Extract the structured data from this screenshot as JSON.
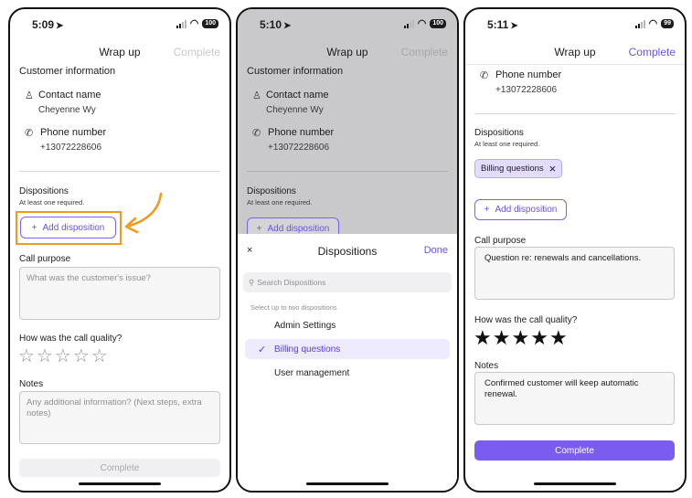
{
  "screens": [
    {
      "status": {
        "time": "5:09",
        "battery": "100"
      },
      "nav": {
        "title": "Wrap up",
        "action": "Complete"
      },
      "customer_info_title": "Customer information",
      "contact": {
        "label": "Contact name",
        "value": "Cheyenne Wy"
      },
      "phone": {
        "label": "Phone number",
        "value": "+13072228606"
      },
      "dispositions": {
        "title": "Dispositions",
        "hint": "At least one required.",
        "add_label": "Add disposition"
      },
      "call_purpose": {
        "title": "Call purpose",
        "placeholder": "What was the customer's issue?"
      },
      "quality": {
        "title": "How was the call quality?",
        "rating": 0,
        "max": 5
      },
      "notes": {
        "title": "Notes",
        "placeholder": "Any additional information? (Next steps, extra notes)"
      },
      "complete_label": "Complete"
    },
    {
      "status": {
        "time": "5:10",
        "battery": "100"
      },
      "nav": {
        "title": "Wrap up",
        "action": "Complete"
      },
      "customer_info_title": "Customer information",
      "contact": {
        "label": "Contact name",
        "value": "Cheyenne Wy"
      },
      "phone": {
        "label": "Phone number",
        "value": "+13072228606"
      },
      "dispositions": {
        "title": "Dispositions",
        "hint": "At least one required.",
        "add_label": "Add disposition"
      },
      "sheet": {
        "close": "×",
        "title": "Dispositions",
        "done": "Done",
        "search_placeholder": "Search Dispositions",
        "hint": "Select up to two dispositions",
        "options": [
          {
            "label": "Admin Settings",
            "selected": false
          },
          {
            "label": "Billing questions",
            "selected": true
          },
          {
            "label": "User management",
            "selected": false
          }
        ]
      }
    },
    {
      "status": {
        "time": "5:11",
        "battery": "99"
      },
      "nav": {
        "title": "Wrap up",
        "action": "Complete"
      },
      "phone": {
        "label": "Phone number",
        "value": "+13072228606"
      },
      "dispositions": {
        "title": "Dispositions",
        "hint": "At least one required.",
        "chip": "Billing questions",
        "add_label": "Add disposition"
      },
      "call_purpose": {
        "title": "Call purpose",
        "value": "Question re: renewals and cancellations."
      },
      "quality": {
        "title": "How was the call quality?",
        "rating": 5,
        "max": 5
      },
      "notes": {
        "title": "Notes",
        "value": "Confirmed customer will keep automatic renewal."
      },
      "complete_label": "Complete"
    }
  ],
  "colors": {
    "accent": "#7b5cf0",
    "highlight": "#f39a1e"
  }
}
